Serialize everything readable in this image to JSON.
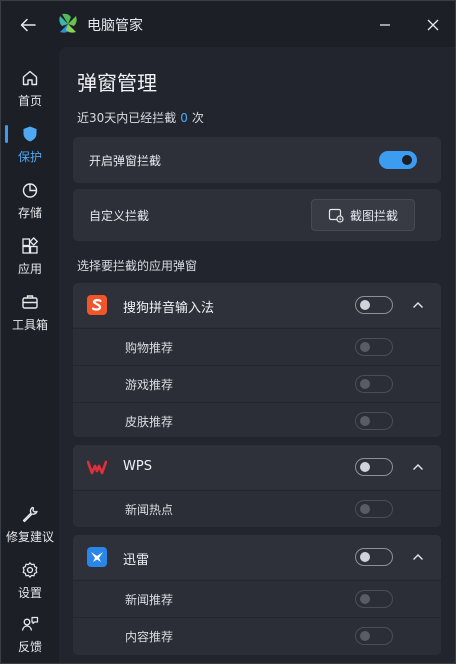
{
  "app": {
    "title": "电脑管家"
  },
  "sidebar": {
    "items": [
      {
        "label": "首页"
      },
      {
        "label": "保护"
      },
      {
        "label": "存储"
      },
      {
        "label": "应用"
      },
      {
        "label": "工具箱"
      },
      {
        "label": "修复建议"
      },
      {
        "label": "设置"
      },
      {
        "label": "反馈"
      }
    ],
    "active_index": 1
  },
  "page": {
    "title": "弹窗管理",
    "summary_prefix": "近30天内已经拦截",
    "summary_count": "0",
    "summary_suffix": "次",
    "master_toggle_label": "开启弹窗拦截",
    "master_toggle_on": true,
    "custom_label": "自定义拦截",
    "screenshot_button": "截图拦截",
    "section_label": "选择要拦截的应用弹窗"
  },
  "apps": [
    {
      "name": "搜狗拼音输入法",
      "icon": "sogou-icon",
      "enabled": false,
      "items": [
        {
          "label": "购物推荐"
        },
        {
          "label": "游戏推荐"
        },
        {
          "label": "皮肤推荐"
        }
      ]
    },
    {
      "name": "WPS",
      "icon": "wps-icon",
      "enabled": false,
      "items": [
        {
          "label": "新闻热点"
        }
      ]
    },
    {
      "name": "迅雷",
      "icon": "xunlei-icon",
      "enabled": false,
      "items": [
        {
          "label": "新闻推荐"
        },
        {
          "label": "内容推荐"
        }
      ]
    }
  ],
  "colors": {
    "accent": "#3b9cf0",
    "panel": "#22252d",
    "card": "#2d3039",
    "background": "#1c1f26"
  }
}
